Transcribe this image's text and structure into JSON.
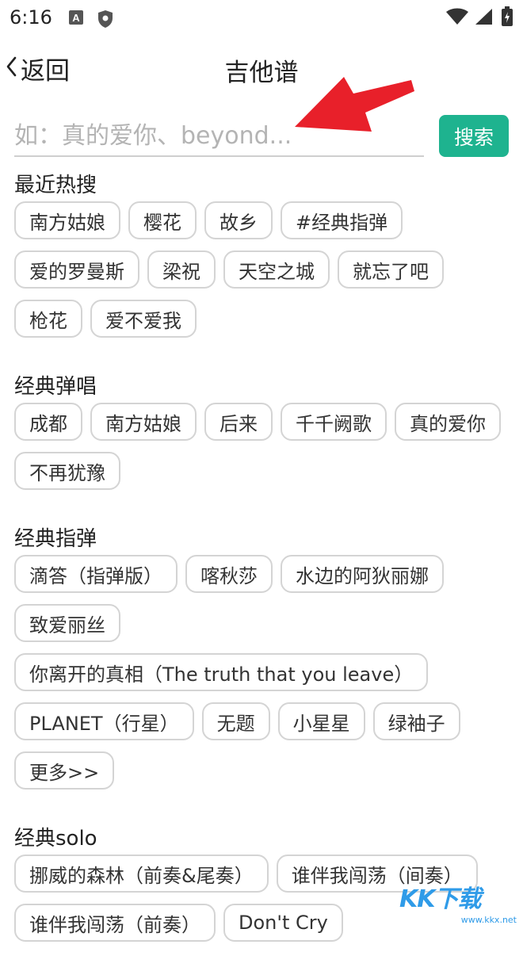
{
  "status_bar": {
    "time": "6:16",
    "left_icons": [
      "a-app-icon",
      "shield-icon"
    ],
    "right_icons": [
      "wifi-icon",
      "signal-icon",
      "battery-icon"
    ]
  },
  "nav": {
    "back_label": "返回",
    "title": "吉他谱"
  },
  "search": {
    "placeholder": "如：真的爱你、beyond...",
    "value": "",
    "button_label": "搜索"
  },
  "annotation": {
    "arrow_color": "#e8202a"
  },
  "accent_color": "#1eb38f",
  "sections": [
    {
      "title": "最近热搜",
      "tags": [
        "南方姑娘",
        "樱花",
        "故乡",
        "#经典指弹",
        "爱的罗曼斯",
        "梁祝",
        "天空之城",
        "就忘了吧",
        "枪花",
        "爱不爱我"
      ]
    },
    {
      "title": "经典弹唱",
      "tags": [
        "成都",
        "南方姑娘",
        "后来",
        "千千阙歌",
        "真的爱你",
        "不再犹豫"
      ]
    },
    {
      "title": "经典指弹",
      "tags": [
        "滴答（指弹版）",
        "喀秋莎",
        "水边的阿狄丽娜",
        "致爱丽丝",
        "你离开的真相（The truth that you leave）",
        "PLANET（行星）",
        "无题",
        "小星星",
        "绿袖子",
        "更多>>"
      ]
    },
    {
      "title": "经典solo",
      "tags": [
        "挪威的森林（前奏&尾奏）",
        "谁伴我闯荡（间奏）",
        "谁伴我闯荡（前奏）",
        "Don't Cry"
      ]
    }
  ],
  "watermark": {
    "brand": "KK下载",
    "url": "www.kkx.net"
  }
}
